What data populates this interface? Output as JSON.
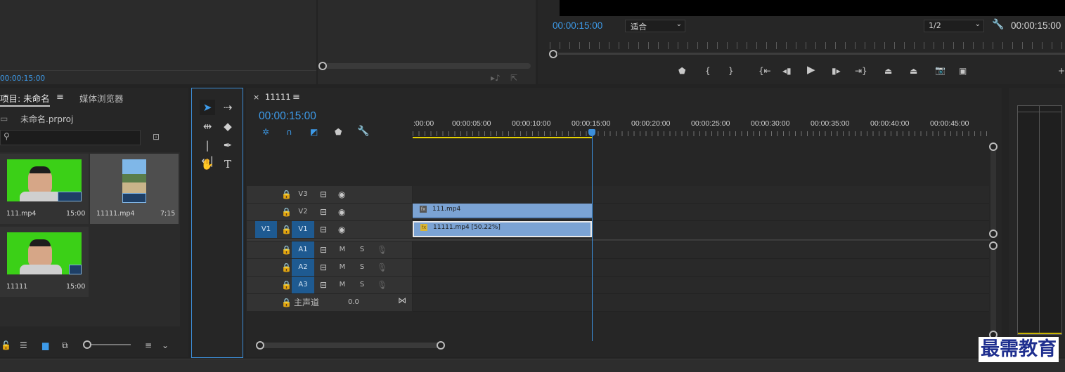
{
  "source_panel": {
    "timecode": "00:00:15:00"
  },
  "program_monitor": {
    "timecode": "00:00:15:00",
    "fit_select": "适合",
    "resolution_select": "1/2",
    "duration": "00:00:15:00"
  },
  "project_panel": {
    "tab_title": "项目: 未命名",
    "tab_menu": "≡",
    "media_browser_tab": "媒体浏览器",
    "file_name": "未命名.prproj",
    "search_placeholder": "",
    "items": [
      {
        "name": "111.mp4",
        "duration": "15:00"
      },
      {
        "name": "11111.mp4",
        "duration": "7;15"
      },
      {
        "name": "11111",
        "duration": "15:00"
      }
    ]
  },
  "timeline": {
    "close": "×",
    "sequence_name": "11111",
    "menu": "≡",
    "playhead_timecode": "00:00:15:00",
    "ruler_labels": [
      ":00:00",
      "00:00:05:00",
      "00:00:10:00",
      "00:00:15:00",
      "00:00:20:00",
      "00:00:25:00",
      "00:00:30:00",
      "00:00:35:00",
      "00:00:40:00",
      "00:00:45:00"
    ],
    "video_tracks": [
      {
        "label": "V3",
        "source": ""
      },
      {
        "label": "V2",
        "source": ""
      },
      {
        "label": "V1",
        "source": "V1"
      }
    ],
    "audio_tracks": [
      {
        "label": "A1",
        "m": "M",
        "s": "S"
      },
      {
        "label": "A2",
        "m": "M",
        "s": "S"
      },
      {
        "label": "A3",
        "m": "M",
        "s": "S"
      }
    ],
    "master": {
      "label": "主声道",
      "value": "0.0"
    },
    "clips": [
      {
        "name": "111.mp4",
        "track": "V2",
        "badge": "fx"
      },
      {
        "name": "11111.mp4 [50.22%]",
        "track": "V1",
        "badge": "fx"
      }
    ]
  },
  "watermark": "最需教育",
  "colors": {
    "accent_blue": "#3d9ae8",
    "clip_blue": "#7ba3d4",
    "track_blue": "#1e5a91",
    "playhead_line": "#3b8fdb",
    "green_screen": "#3bd017",
    "work_area": "#e6d200"
  }
}
